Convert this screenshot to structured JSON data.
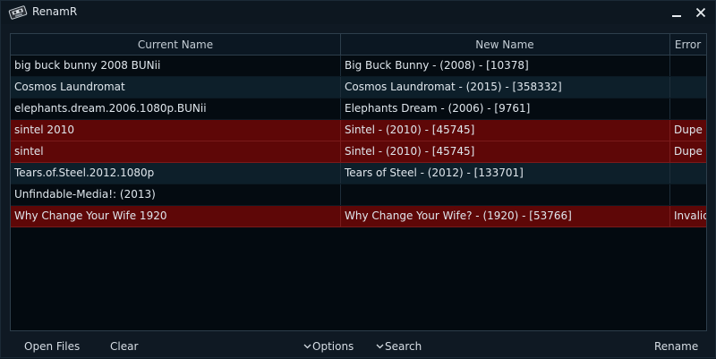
{
  "app": {
    "title": "RenamR",
    "icons": {
      "app": "tape-icon",
      "minimize": "minimize-icon",
      "close": "close-icon"
    }
  },
  "table": {
    "columns": [
      "Current Name",
      "New Name",
      "Error"
    ],
    "rows": [
      {
        "current": "big buck bunny 2008 BUNii",
        "new": "Big Buck Bunny - (2008) - [10378]",
        "error": "",
        "status": "ok"
      },
      {
        "current": "Cosmos Laundromat",
        "new": "Cosmos Laundromat - (2015) - [358332]",
        "error": "",
        "status": "ok"
      },
      {
        "current": "elephants.dream.2006.1080p.BUNii",
        "new": "Elephants Dream - (2006) - [9761]",
        "error": "",
        "status": "ok"
      },
      {
        "current": "sintel 2010",
        "new": "Sintel - (2010) - [45745]",
        "error": "Dupe",
        "status": "error"
      },
      {
        "current": "sintel",
        "new": "Sintel - (2010) - [45745]",
        "error": "Dupe",
        "status": "error"
      },
      {
        "current": "Tears.of.Steel.2012.1080p",
        "new": "Tears of Steel - (2012) - [133701]",
        "error": "",
        "status": "ok"
      },
      {
        "current": "Unfindable-Media!: (2013)",
        "new": "",
        "error": "",
        "status": "ok"
      },
      {
        "current": "Why Change Your Wife 1920",
        "new": "Why Change Your Wife? - (1920) - [53766]",
        "error": "Invalid",
        "status": "error"
      }
    ]
  },
  "toolbar": {
    "open_files": "Open Files",
    "clear": "Clear",
    "options": "Options",
    "search": "Search",
    "rename": "Rename",
    "expander_icon": "chevron-down-icon"
  },
  "colors": {
    "background": "#0f1923",
    "grid_background": "#030a10",
    "row_alt": "#0d1f2a",
    "row_error": "#5e0707",
    "text": "#dfe6ec"
  }
}
